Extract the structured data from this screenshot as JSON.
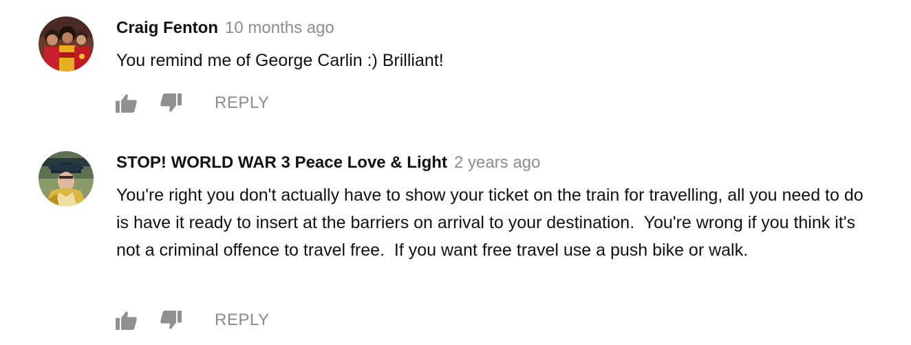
{
  "colors": {
    "author": "#111111",
    "timestamp": "#8c8c8c",
    "icon": "#909090",
    "reply": "#8a8a8a"
  },
  "comments": [
    {
      "author": "Craig Fenton",
      "timestamp": "10 months ago",
      "text": "You remind me of George Carlin :) Brilliant!",
      "reply_label": "REPLY",
      "like_icon": "thumb-up-icon",
      "dislike_icon": "thumb-down-icon"
    },
    {
      "author": "STOP! WORLD WAR 3 Peace Love & Light",
      "timestamp": "2 years ago",
      "text": "You're right you don't actually have to show your ticket on the train for travelling, all you need to do is have it ready to insert at the barriers on arrival to your destination.  You're wrong if you think it's not a criminal offence to travel free.  If you want free travel use a push bike or walk.",
      "reply_label": "REPLY",
      "like_icon": "thumb-up-icon",
      "dislike_icon": "thumb-down-icon"
    }
  ]
}
